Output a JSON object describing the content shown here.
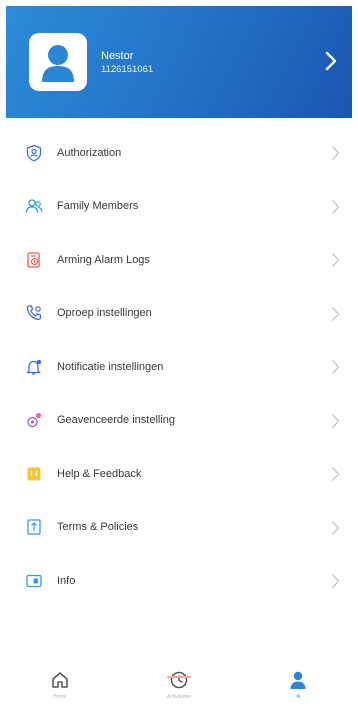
{
  "profile": {
    "name": "Nestor",
    "phone": "1126151061"
  },
  "menu": [
    {
      "label": "Authorization",
      "icon": "shield-person-icon",
      "color": "#3c6fe0"
    },
    {
      "label": "Family Members",
      "icon": "family-members-icon",
      "color": "#2f9bea"
    },
    {
      "label": "Arming Alarm Logs",
      "icon": "alarm-log-icon",
      "color": "#e55a5a"
    },
    {
      "label": "Oproep instellingen",
      "icon": "phone-settings-icon",
      "color": "#3a64d8"
    },
    {
      "label": "Notificatie instellingen",
      "icon": "bell-settings-icon",
      "color": "#3a64d8"
    },
    {
      "label": "Geavenceerde instelling",
      "icon": "advanced-settings-icon",
      "color": "#9a59e0"
    },
    {
      "label": "Help & Feedback",
      "icon": "help-feedback-icon",
      "color": "#f5c531"
    },
    {
      "label": "Terms & Policies",
      "icon": "terms-policies-icon",
      "color": "#2f9bea"
    },
    {
      "label": "Info",
      "icon": "info-icon",
      "color": "#2f9bea"
    }
  ],
  "tabs": [
    {
      "label": "Home",
      "icon": "home-icon"
    },
    {
      "label": "Activiteiten",
      "icon": "clock-icon"
    },
    {
      "label": "Ik",
      "icon": "user-icon"
    }
  ],
  "colors": {
    "accent": "#2a86d6",
    "header_gradient_start": "#2c8bd8",
    "header_gradient_end": "#1a56b2"
  }
}
